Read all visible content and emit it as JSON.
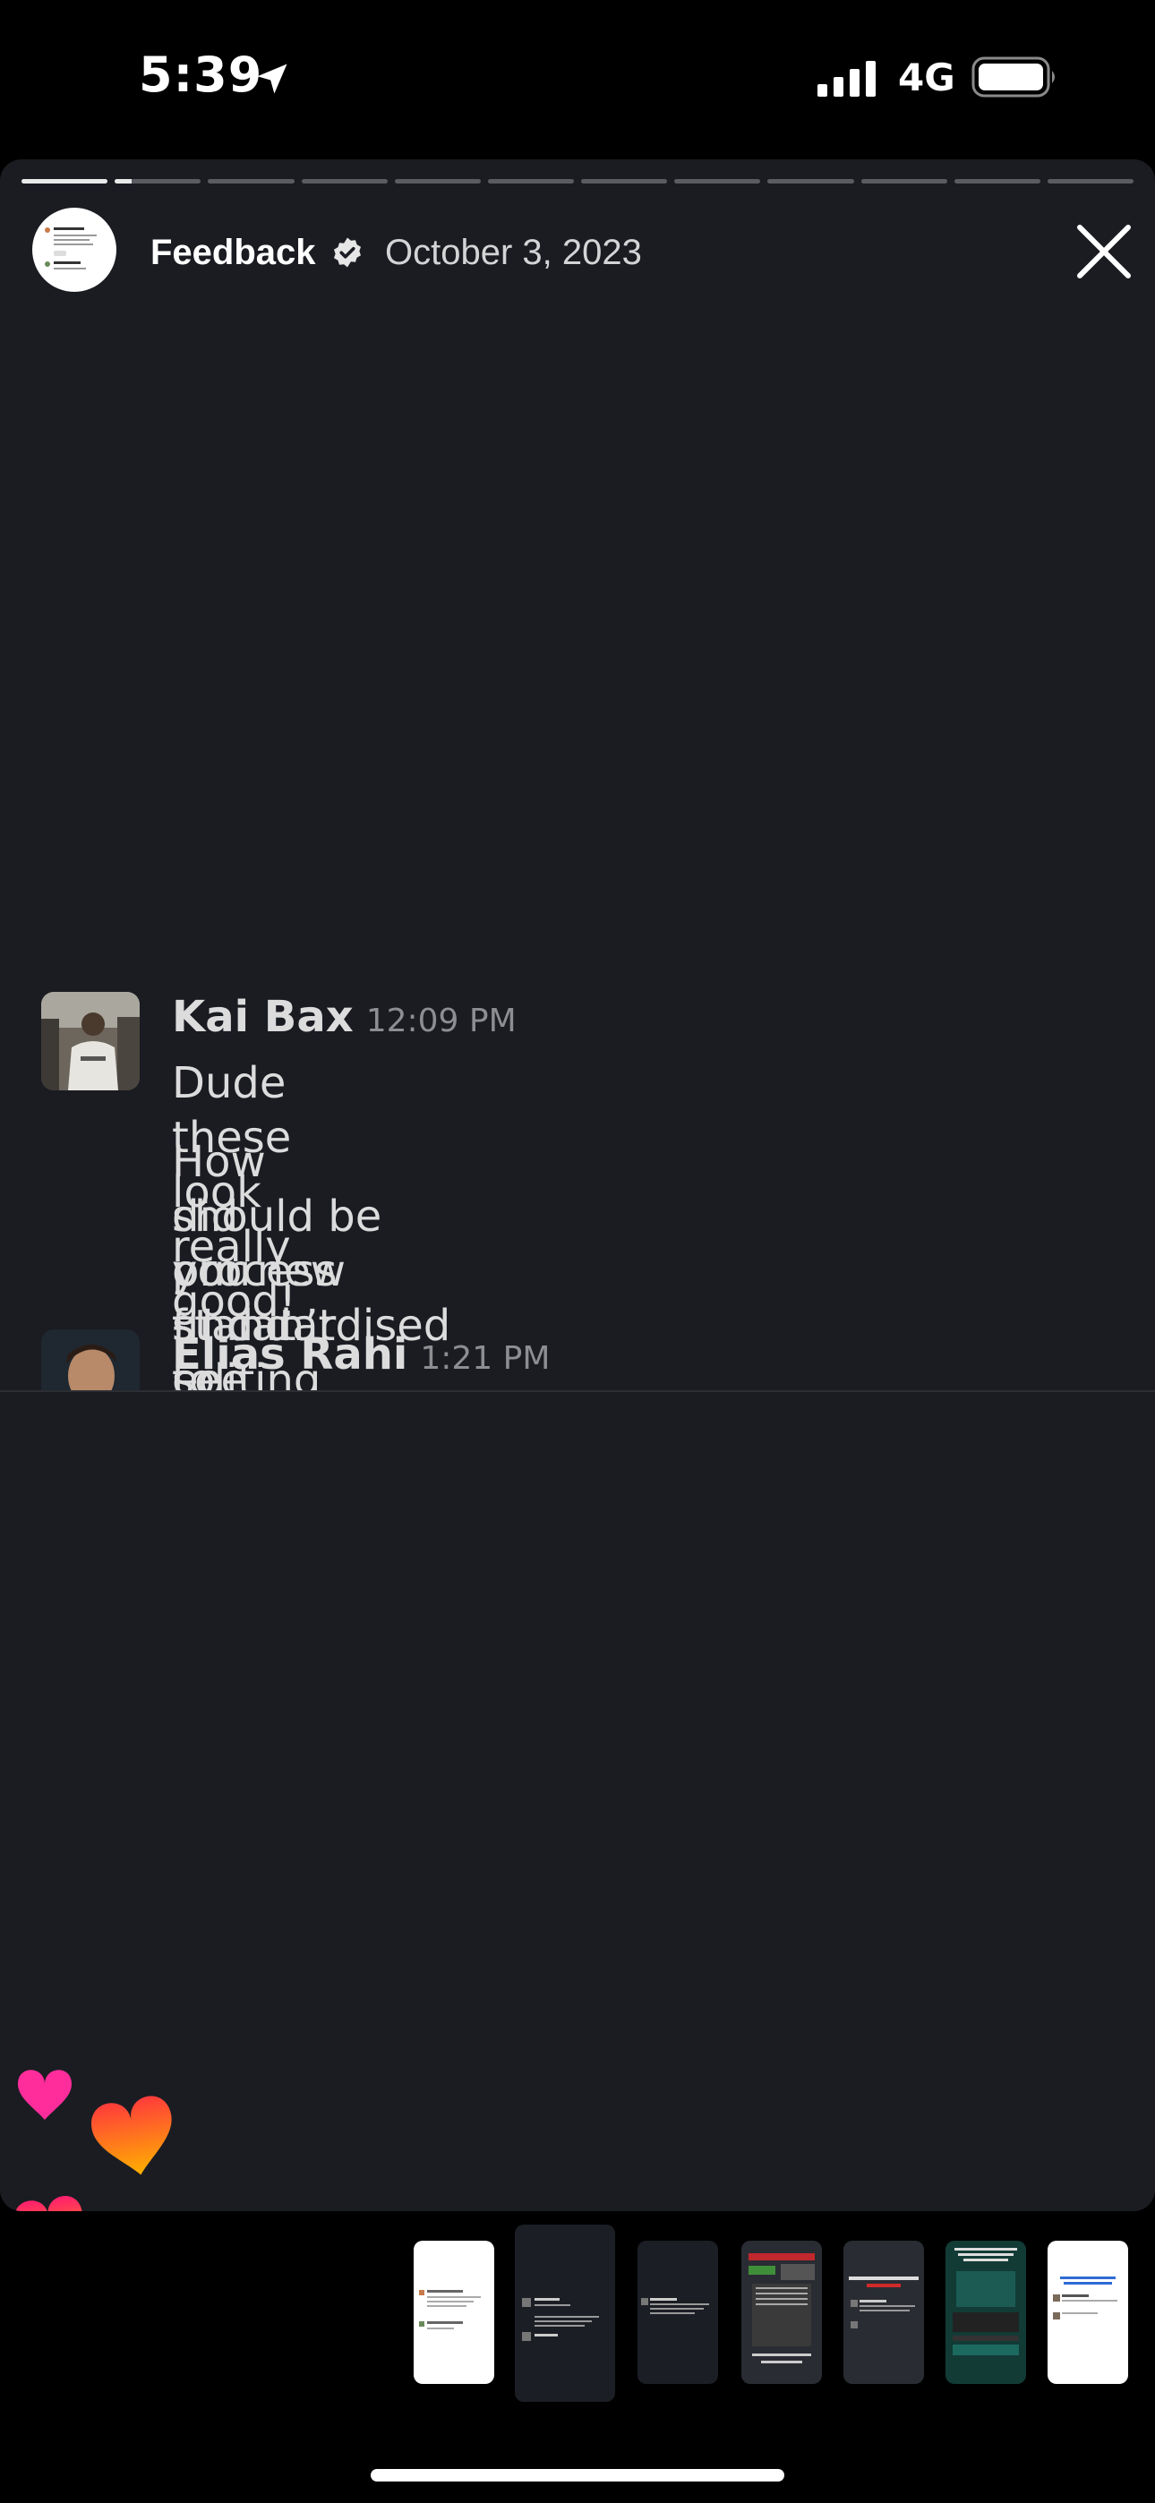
{
  "status_bar": {
    "time": "5:39",
    "network": "4G"
  },
  "story": {
    "title": "Feedback",
    "date": "October 3, 2023",
    "segments_total": 12,
    "current_segment": 2,
    "current_progress": 0.2
  },
  "messages": [
    {
      "author": "Kai Bax",
      "time": "12:09 PM",
      "lines": [
        "Dude these look really good!"
      ],
      "paragraph2": [
        "How did you find it to create these? I think this",
        "should be our new standardised editing",
        "process - I can’t see clients not liking these!"
      ]
    },
    {
      "author": "Elias Rahi",
      "time": "1:21 PM"
    }
  ],
  "reactions": {
    "type": "hearts"
  },
  "thumbnails": [
    {
      "id": "thumb-1",
      "theme": "light"
    },
    {
      "id": "thumb-2",
      "theme": "dark",
      "active": true
    },
    {
      "id": "thumb-3",
      "theme": "dark"
    },
    {
      "id": "thumb-4",
      "theme": "dark-red"
    },
    {
      "id": "thumb-5",
      "theme": "dark"
    },
    {
      "id": "thumb-6",
      "theme": "teal"
    },
    {
      "id": "thumb-7",
      "theme": "light-blue"
    }
  ],
  "colors": {
    "background": "#1a1c22",
    "accent_heart_pink": "#ff2d9b",
    "accent_heart_orange": "#ff8a00"
  }
}
